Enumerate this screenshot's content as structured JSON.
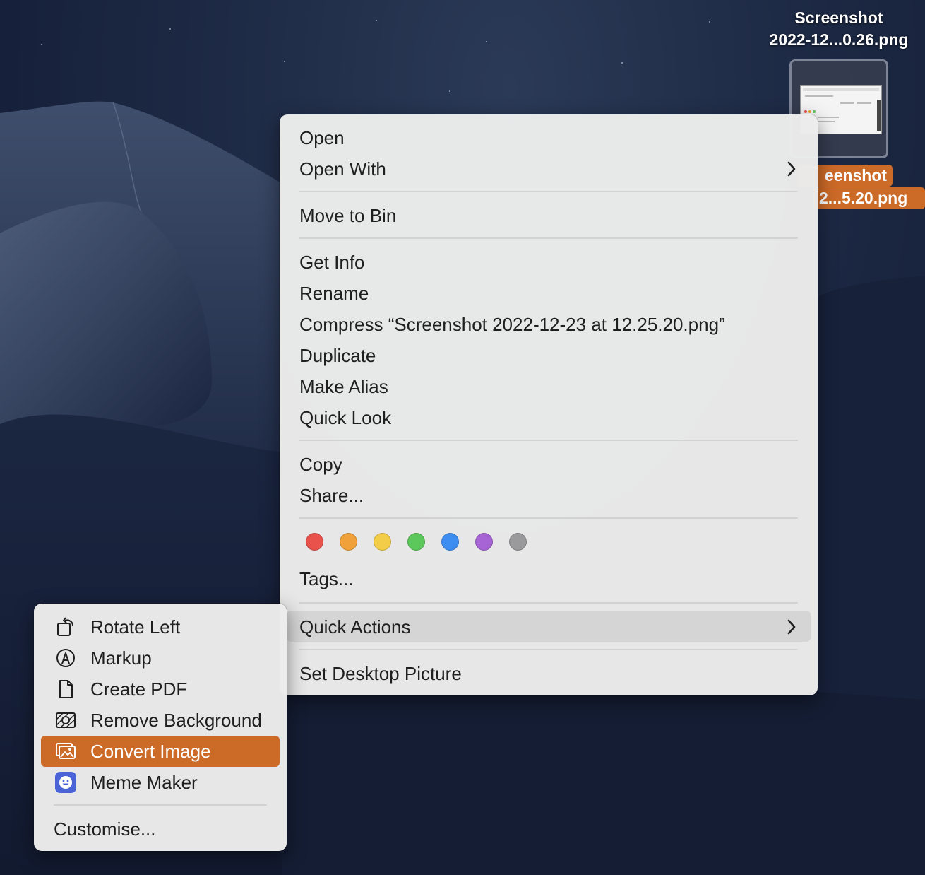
{
  "desktop": {
    "icons": [
      {
        "label_line1": "Screenshot",
        "label_line2": "2022-12...0.26.png",
        "selected": false
      },
      {
        "label_line1": "eenshot",
        "label_line2": "2...5.20.png",
        "selected": true
      }
    ]
  },
  "context_menu": {
    "groups": [
      [
        {
          "label": "Open"
        },
        {
          "label": "Open With",
          "has_submenu": true
        }
      ],
      [
        {
          "label": "Move to Bin"
        }
      ],
      [
        {
          "label": "Get Info"
        },
        {
          "label": "Rename"
        },
        {
          "label": "Compress “Screenshot 2022-12-23 at 12.25.20.png”"
        },
        {
          "label": "Duplicate"
        },
        {
          "label": "Make Alias"
        },
        {
          "label": "Quick Look"
        }
      ],
      [
        {
          "label": "Copy"
        },
        {
          "label": "Share..."
        }
      ],
      [
        {
          "label": "Tags..."
        }
      ],
      [
        {
          "label": "Quick Actions",
          "has_submenu": true,
          "highlighted": true
        }
      ],
      [
        {
          "label": "Set Desktop Picture"
        }
      ]
    ],
    "tag_colors": [
      {
        "name": "red",
        "color": "#e8524a"
      },
      {
        "name": "orange",
        "color": "#f0a13a"
      },
      {
        "name": "yellow",
        "color": "#f3cd47"
      },
      {
        "name": "green",
        "color": "#5cc75a"
      },
      {
        "name": "blue",
        "color": "#3d8ef0"
      },
      {
        "name": "purple",
        "color": "#a664d5"
      },
      {
        "name": "gray",
        "color": "#9a9a9d"
      }
    ]
  },
  "quick_actions_menu": {
    "items": [
      {
        "label": "Rotate Left",
        "icon": "rotate-left-icon"
      },
      {
        "label": "Markup",
        "icon": "markup-icon"
      },
      {
        "label": "Create PDF",
        "icon": "document-icon"
      },
      {
        "label": "Remove Background",
        "icon": "remove-background-icon"
      },
      {
        "label": "Convert Image",
        "icon": "convert-image-icon",
        "highlighted": true
      },
      {
        "label": "Meme Maker",
        "icon": "meme-maker-icon"
      }
    ],
    "customise_label": "Customise..."
  },
  "colors": {
    "accent": "#cc6a28",
    "menu_bg": "#ececec",
    "highlight": "#d5d5d5"
  }
}
